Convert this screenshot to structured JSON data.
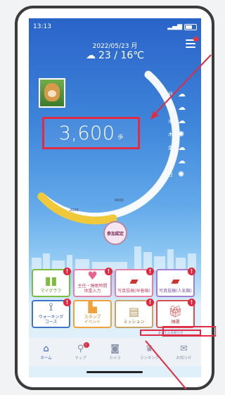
{
  "status": {
    "time": "13:13"
  },
  "header": {
    "date": "2022/05/23 月",
    "temperature": "23 / 16℃"
  },
  "steps": {
    "value": "3,600",
    "unit": "歩"
  },
  "forecast": [
    {
      "day": "月",
      "icon": "cloud-icon"
    },
    {
      "day": "火",
      "icon": "cloud-icon"
    },
    {
      "day": "水",
      "icon": "cloud-icon"
    },
    {
      "day": "木",
      "icon": "sun-icon"
    },
    {
      "day": "金",
      "icon": "cloud-icon"
    },
    {
      "day": "土",
      "icon": "cloud-icon"
    },
    {
      "day": "日",
      "icon": "sun-icon"
    }
  ],
  "gauge": {
    "progress": 0.36
  },
  "gauge_labels": {
    "a": "2000",
    "b": "4000"
  },
  "event_button": {
    "label": "参加認定"
  },
  "tiles": [
    {
      "label": "マイグラフ",
      "icon": "graph-icon",
      "badge": "!"
    },
    {
      "label": "主任・睡眠時間\n体重入力",
      "icon": "heart-icon",
      "badge": "!"
    },
    {
      "label": "写真投稿(早着順)",
      "icon": "photo-icon",
      "badge": "!"
    },
    {
      "label": "写真投稿(人気順)",
      "icon": "photo-icon",
      "badge": "!"
    },
    {
      "label": "ウォーキング\nコース",
      "icon": "route-icon",
      "badge": "!"
    },
    {
      "label": "スタンプ\nイベント",
      "icon": "stamp-icon",
      "badge": ""
    },
    {
      "label": "ミッション",
      "icon": "mission-icon",
      "badge": "!"
    },
    {
      "label": "抽選",
      "icon": "gift-icon",
      "badge": "!"
    }
  ],
  "notice": {
    "text": "まいたんお知らせ"
  },
  "tabbar": [
    {
      "label": "ホーム",
      "icon": "home-icon",
      "badge": ""
    },
    {
      "label": "マップ",
      "icon": "map-pin-icon",
      "badge": "!"
    },
    {
      "label": "カメラ",
      "icon": "camera-icon",
      "badge": ""
    },
    {
      "label": "ランキング",
      "icon": "crown-icon",
      "badge": ""
    },
    {
      "label": "お知らせ",
      "icon": "message-icon",
      "badge": ""
    }
  ],
  "colors": {
    "highlight": "#e02b44",
    "sky_top": "#2a63c8",
    "accent": "#2e5fb5"
  }
}
